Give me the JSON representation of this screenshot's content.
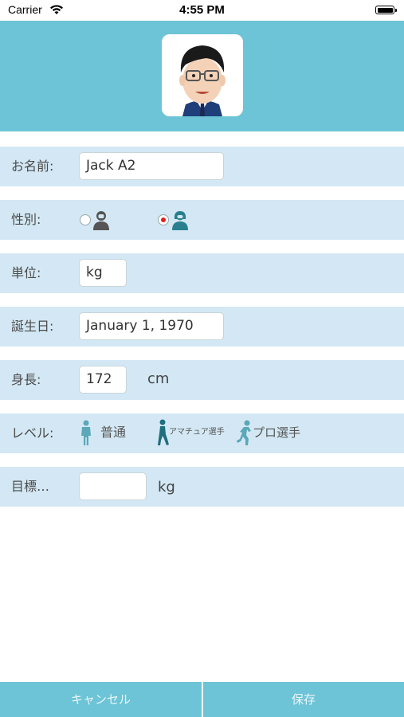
{
  "status": {
    "carrier": "Carrier",
    "time": "4:55 PM"
  },
  "form": {
    "name": {
      "label": "お名前:",
      "value": "Jack A2"
    },
    "gender": {
      "label": "性別:",
      "selected": "female"
    },
    "unit": {
      "label": "単位:",
      "value": "kg"
    },
    "birthday": {
      "label": "誕生日:",
      "value": "January 1, 1970"
    },
    "height": {
      "label": "身長:",
      "value": "172",
      "unit": "cm"
    },
    "level": {
      "label": "レベル:",
      "options": [
        "普通",
        "アマチュア選手",
        "プロ選手"
      ]
    },
    "target": {
      "label": "目標…",
      "value": "",
      "unit": "kg"
    }
  },
  "footer": {
    "cancel_label": "キャンセル",
    "save_label": "保存"
  },
  "colors": {
    "accent": "#6cc4d6",
    "row": "#d3e8f4",
    "figure": "#5aa8b8"
  }
}
